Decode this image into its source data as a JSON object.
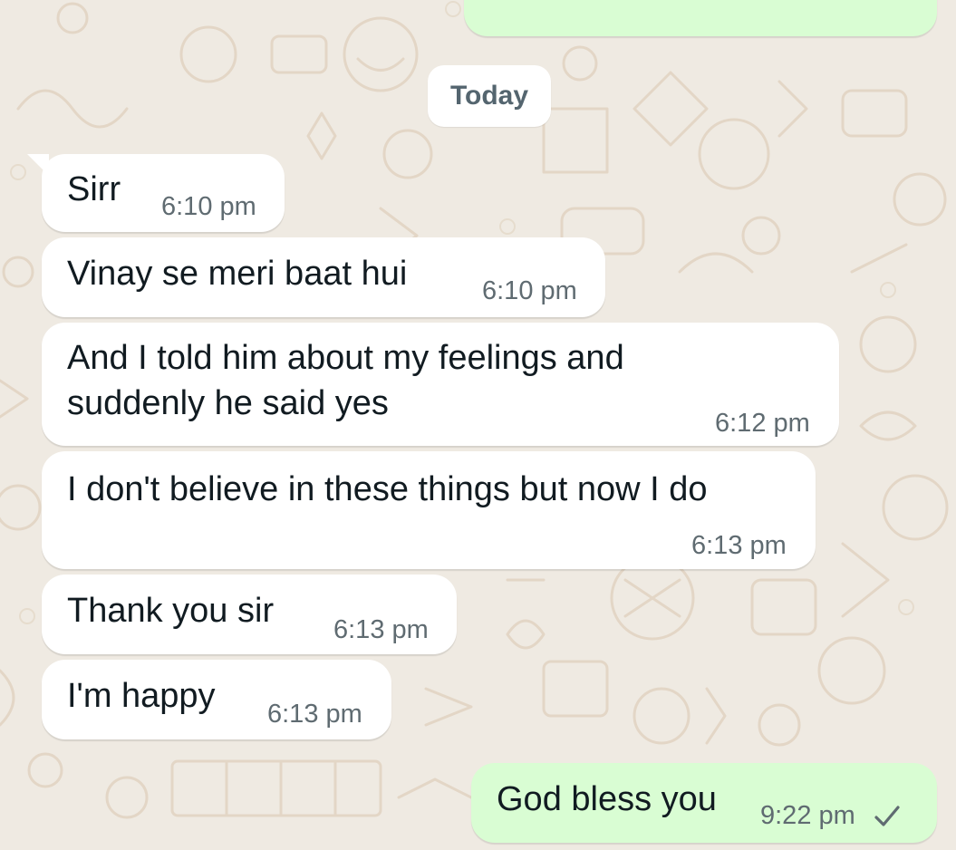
{
  "date_chip": "Today",
  "messages": [
    {
      "direction": "incoming",
      "text": "Sirr",
      "time": "6:10 pm"
    },
    {
      "direction": "incoming",
      "text": "Vinay se meri baat hui",
      "time": "6:10 pm"
    },
    {
      "direction": "incoming",
      "lines": [
        "And I told him about my feelings and",
        "suddenly he said yes"
      ],
      "time": "6:12 pm"
    },
    {
      "direction": "incoming",
      "text": "I don't believe in these things but now I do",
      "time": "6:13 pm"
    },
    {
      "direction": "incoming",
      "text": "Thank you sir",
      "time": "6:13 pm"
    },
    {
      "direction": "incoming",
      "text": "I'm happy",
      "time": "6:13 pm"
    },
    {
      "direction": "outgoing",
      "text": "God bless you",
      "time": "9:22 pm",
      "status_icon": "single-check-icon"
    }
  ],
  "colors": {
    "background": "#efeae2",
    "incoming_bubble": "#ffffff",
    "outgoing_bubble": "#d9fdd3",
    "text": "#111b21",
    "time": "#5f6b71"
  }
}
